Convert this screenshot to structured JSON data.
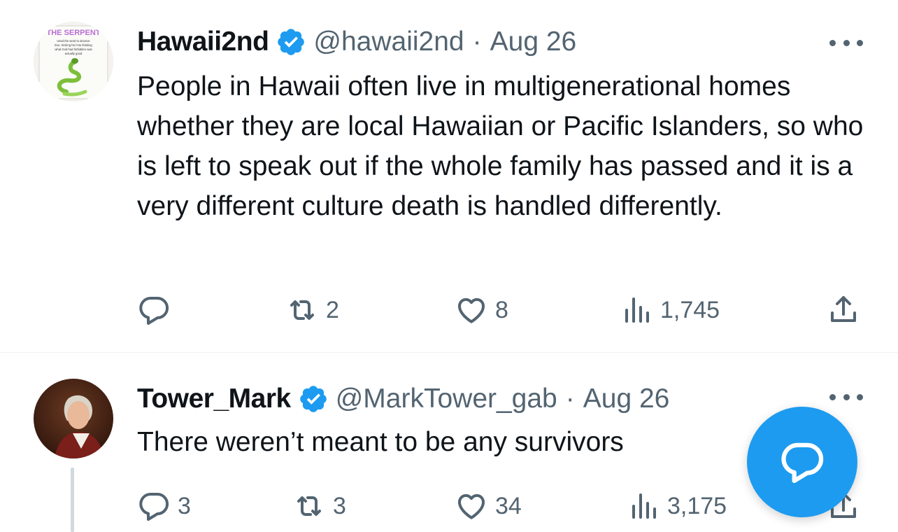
{
  "tweets": [
    {
      "author_name": "Hawaii2nd",
      "handle": "@hawaii2nd",
      "separator": "·",
      "date": "Aug 26",
      "text": "People in Hawaii often live in multigenerational homes whether they are local Hawaiian or Pacific Islanders, so who is left to speak out if the whole family has passed and it is a very different culture death is handled differently.",
      "avatar": {
        "title": "THE SERPENT",
        "caption": [
          "Used the word to deceive",
          "Eve, tricking her into thinking",
          "what God had forbidden was",
          "actually good"
        ]
      },
      "actions": {
        "replies": "",
        "reposts": "2",
        "likes": "8",
        "views": "1,745"
      }
    },
    {
      "author_name": "Tower_Mark",
      "handle": "@MarkTower_gab",
      "separator": "·",
      "date": "Aug 26",
      "text": "There weren’t meant to be any survivors",
      "actions": {
        "replies": "3",
        "reposts": "3",
        "likes": "34",
        "views": "3,175"
      }
    }
  ],
  "icons": {
    "verified": "verified-badge-icon",
    "more": "more-icon",
    "reply": "reply-icon",
    "repost": "repost-icon",
    "like": "heart-icon",
    "views": "views-icon",
    "share": "share-icon",
    "compose": "compose-reply-icon"
  },
  "colors": {
    "accent": "#1d9bf0",
    "muted": "#536471",
    "text": "#0f1419",
    "divider": "#eff3f4"
  }
}
